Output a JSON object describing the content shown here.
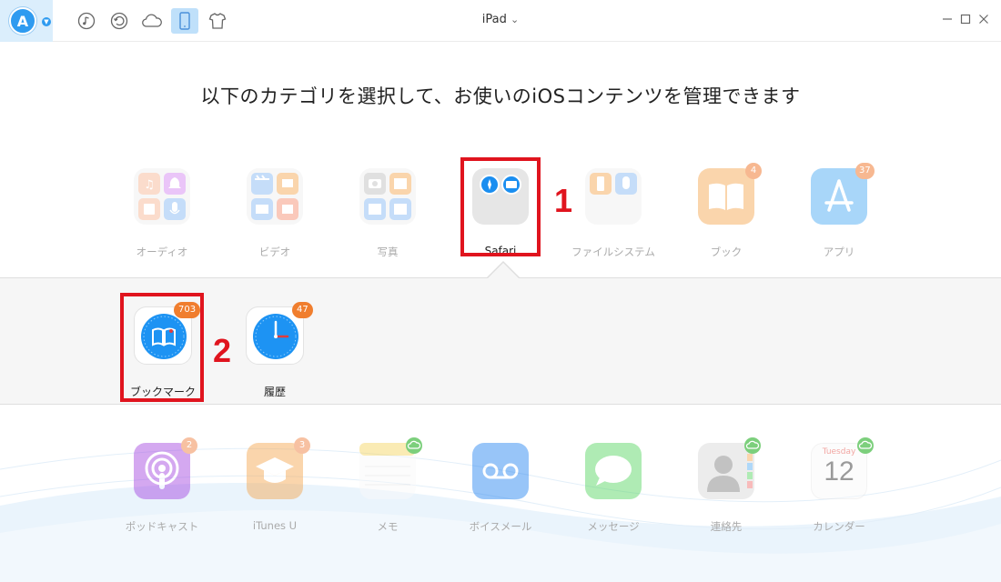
{
  "topbar": {
    "device_name": "iPad",
    "device_caret": "⌄",
    "logo_letter": "A",
    "icons": [
      "music-icon",
      "restore-icon",
      "cloud-icon",
      "device-icon",
      "tshirt-icon"
    ]
  },
  "heading": "以下のカテゴリを選択して、お使いのiOSコンテンツを管理できます",
  "categories_top": [
    {
      "label": "オーディオ",
      "icon": "audio-category-icon",
      "badge": ""
    },
    {
      "label": "ビデオ",
      "icon": "video-category-icon",
      "badge": ""
    },
    {
      "label": "写真",
      "icon": "photo-category-icon",
      "badge": ""
    },
    {
      "label": "Safari",
      "icon": "safari-category-icon",
      "badge": "",
      "selected": true
    },
    {
      "label": "ファイルシステム",
      "icon": "filesystem-category-icon",
      "badge": ""
    },
    {
      "label": "ブック",
      "icon": "book-category-icon",
      "badge": "4"
    },
    {
      "label": "アプリ",
      "icon": "app-category-icon",
      "badge": "37"
    }
  ],
  "subitems": [
    {
      "label": "ブックマーク",
      "badge": "703",
      "icon": "bookmark-icon",
      "selected": true
    },
    {
      "label": "履歴",
      "badge": "47",
      "icon": "history-icon"
    }
  ],
  "categories_bottom": [
    {
      "label": "ポッドキャスト",
      "icon": "podcast-icon",
      "badge": "2"
    },
    {
      "label": "iTunes U",
      "icon": "itunes-u-icon",
      "badge": "3"
    },
    {
      "label": "メモ",
      "icon": "notes-icon",
      "badge": ""
    },
    {
      "label": "ボイスメール",
      "icon": "voicemail-icon",
      "badge": ""
    },
    {
      "label": "メッセージ",
      "icon": "messages-icon",
      "badge": ""
    },
    {
      "label": "連絡先",
      "icon": "contacts-icon",
      "badge": ""
    },
    {
      "label": "カレンダー",
      "icon": "calendar-icon",
      "badge": ""
    }
  ],
  "calendar_icon": {
    "weekday": "Tuesday",
    "day": "12"
  },
  "annotations": {
    "step1": "1",
    "step2": "2"
  },
  "colors": {
    "accent": "#2f9bf0",
    "highlight": "#e0141e",
    "badge": "#f07e2e"
  }
}
